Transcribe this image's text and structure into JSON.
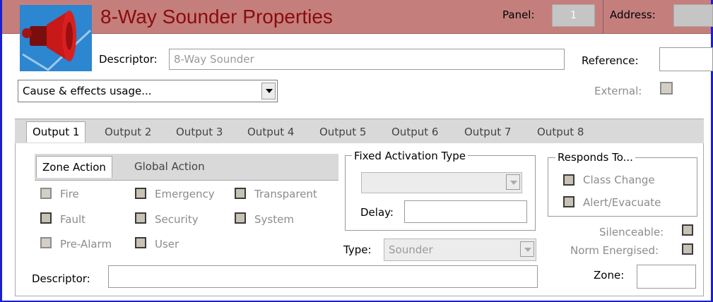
{
  "window": {
    "title": "8-Way Sounder Properties",
    "panel_label": "Panel:",
    "panel_value": "1",
    "address_label": "Address:",
    "address_value": ""
  },
  "header": {
    "descriptor_label": "Descriptor:",
    "descriptor_value": "8-Way Sounder",
    "reference_label": "Reference:",
    "reference_value": "",
    "cause_effects_label": "Cause & effects usage...",
    "external_label": "External:"
  },
  "output_tabs": [
    "Output 1",
    "Output 2",
    "Output 3",
    "Output 4",
    "Output 5",
    "Output 6",
    "Output 7",
    "Output 8"
  ],
  "action_tabs": [
    "Zone Action",
    "Global Action"
  ],
  "zone_actions": {
    "fire": "Fire",
    "fault": "Fault",
    "pre_alarm": "Pre-Alarm",
    "emergency": "Emergency",
    "security": "Security",
    "user": "User",
    "transparent": "Transparent",
    "system": "System"
  },
  "fixed_activation": {
    "title": "Fixed Activation Type",
    "delay_label": "Delay:",
    "delay_value": ""
  },
  "responds_to": {
    "title": "Responds To...",
    "class_change": "Class Change",
    "alert_evacuate": "Alert/Evacuate"
  },
  "output_settings": {
    "type_label": "Type:",
    "type_value": "Sounder",
    "silenceable_label": "Silenceable:",
    "norm_energised_label": "Norm Energised:",
    "zone_label": "Zone:",
    "zone_value": "",
    "descriptor_label": "Descriptor:",
    "descriptor_value": ""
  },
  "icons": {
    "device": "sounder-device-icon"
  },
  "colors": {
    "titlebar": "#c47f7d",
    "title_text": "#8b0b0b",
    "frame_border": "#1a1fd0"
  }
}
